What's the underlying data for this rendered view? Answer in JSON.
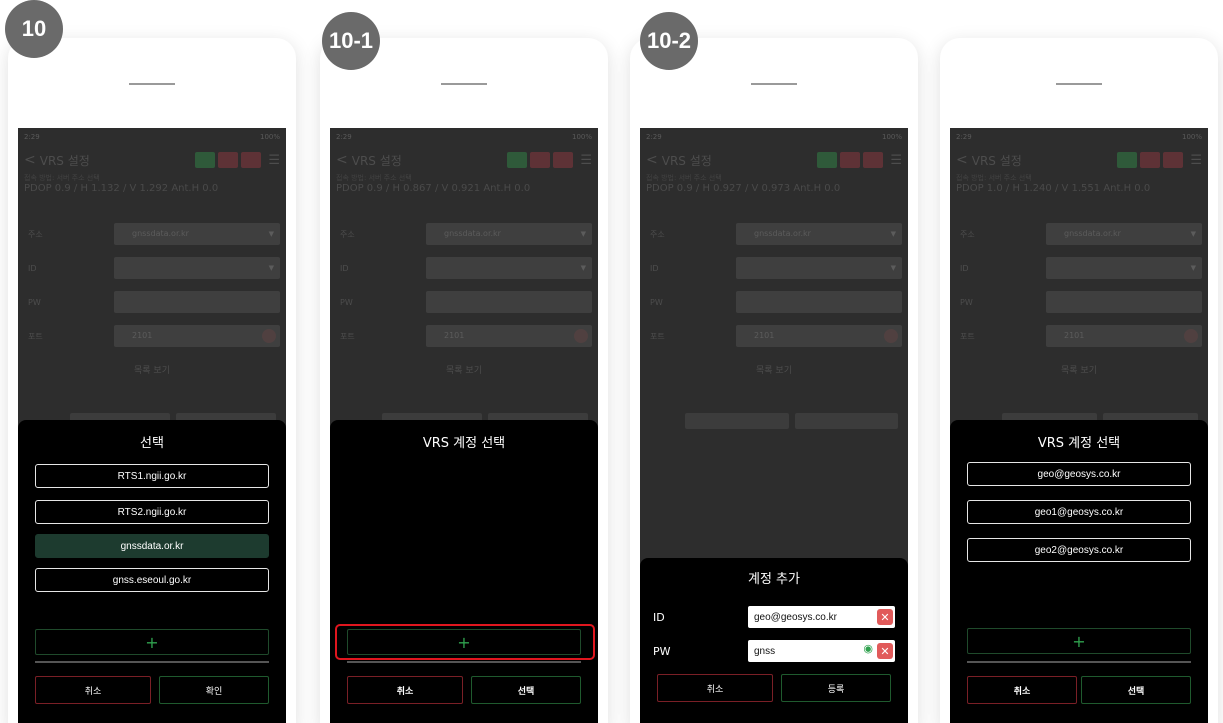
{
  "badges": [
    "10",
    "10-1",
    "10-2"
  ],
  "bg": {
    "status_time": "2:29",
    "status_right": "100%",
    "title": "VRS 설정",
    "back": "<",
    "menu": "☰",
    "sub1": "접속 방법: 서버 주소 선택",
    "sub2_p1": "PDOP 0.9 / H 1.132 / V 1.292   Ant.H 0.0",
    "sub2_p2": "PDOP 0.9 / H 0.867 / V 0.921   Ant.H 0.0",
    "sub2_p3": "PDOP 0.9 / H 0.927 / V 0.973   Ant.H 0.0",
    "sub2_p4": "PDOP 1.0 / H 1.240 / V 1.551   Ant.H 0.0",
    "labels": [
      "주소",
      "ID",
      "PW",
      "포트"
    ],
    "addr": "gnssdata.or.kr",
    "port": "2101",
    "view_list": "목록 보기",
    "dd": "▼"
  },
  "panel1": {
    "title": "선택",
    "options": [
      "RTS1.ngii.go.kr",
      "RTS2.ngii.go.kr",
      "gnssdata.or.kr",
      "gnss.eseoul.go.kr"
    ],
    "plus": "+",
    "cancel": "취소",
    "confirm": "확인"
  },
  "panel2": {
    "title": "VRS 계정 선택",
    "plus": "+",
    "cancel": "취소",
    "select": "선택"
  },
  "panel3": {
    "title": "계정 추가",
    "id_label": "ID",
    "id_value": "geo@geosys.co.kr",
    "pw_label": "PW",
    "pw_value": "gnss",
    "cancel": "취소",
    "register": "등록",
    "x": "✕",
    "eye": "◉"
  },
  "panel4": {
    "title": "VRS 계정 선택",
    "options": [
      "geo@geosys.co.kr",
      "geo1@geosys.co.kr",
      "geo2@geosys.co.kr"
    ],
    "plus": "+",
    "cancel": "취소",
    "select": "선택"
  }
}
